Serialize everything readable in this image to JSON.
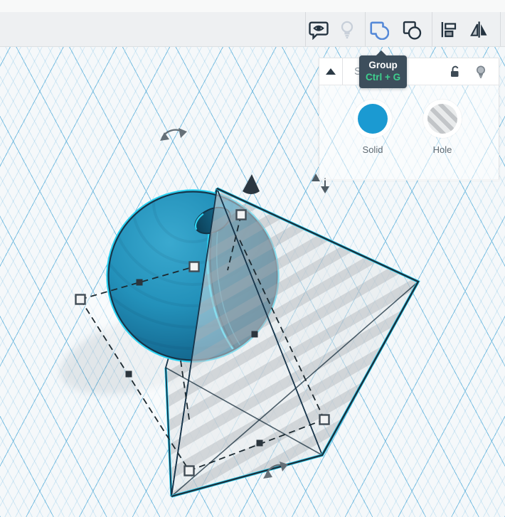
{
  "toolbar": {
    "items": [
      {
        "id": "comment-review",
        "state": "default"
      },
      {
        "id": "light-bulb",
        "state": "disabled"
      },
      {
        "id": "group",
        "state": "highlighted"
      },
      {
        "id": "ungroup",
        "state": "default"
      },
      {
        "id": "align",
        "state": "default"
      },
      {
        "id": "mirror",
        "state": "default"
      }
    ]
  },
  "tooltip": {
    "title": "Group",
    "shortcut": "Ctrl + G"
  },
  "inspector": {
    "title": "Shapes(2)",
    "material_options": [
      {
        "label": "Solid",
        "swatch_color": "#1b9ad2"
      },
      {
        "label": "Hole",
        "swatch_style": "gray-diagonal-stripes"
      }
    ]
  },
  "scene": {
    "objects": [
      {
        "name": "sphere",
        "material": "Solid",
        "color": "#1f86b0",
        "selected": true
      },
      {
        "name": "pyramid",
        "material": "Hole",
        "style": "translucent-striped",
        "selected": true
      }
    ],
    "selection_handle_colors": {
      "corner": "#f2f3f4",
      "mid": "#2b353d"
    },
    "highlight_color": "#2bd2f2"
  },
  "colors": {
    "toolbar_bg": "#eef0f2",
    "canvas_bg": "#f5f8fa",
    "grid_major": "#60b2db",
    "grid_minor": "#8cc8e8",
    "accent_blue": "#5589d8",
    "tooltip_bg": "#3d4e5c",
    "shortcut_green": "#3ecf8e",
    "solid_blue": "#1b9ad2"
  }
}
